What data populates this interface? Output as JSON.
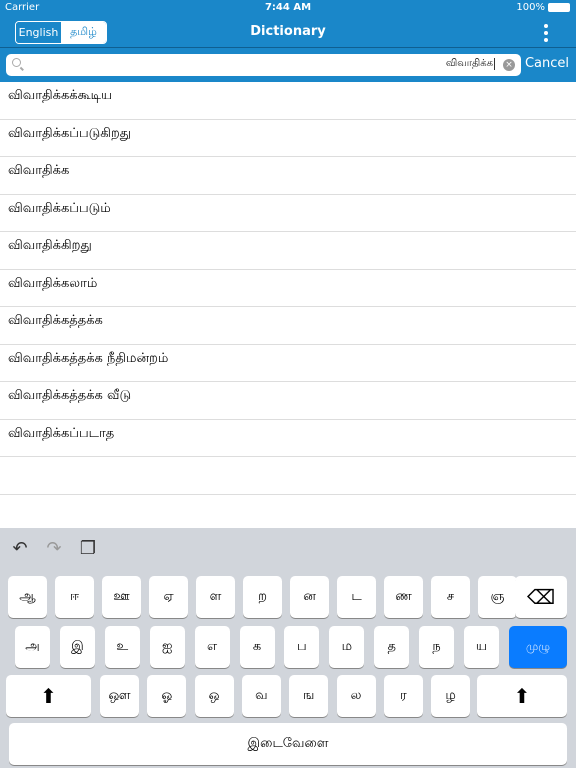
{
  "status": {
    "carrier": "Carrier",
    "time": "7:44 AM",
    "battery": "100%"
  },
  "nav": {
    "lang_english": "English",
    "lang_tamil": "தமிழ்",
    "title": "Dictionary"
  },
  "search": {
    "value": "விவாதிக்க",
    "cancel": "Cancel"
  },
  "results": [
    "விவாதிக்கக்கூடிய",
    "விவாதிக்கப்படுகிறது",
    "விவாதிக்க",
    "விவாதிக்கப்படும்",
    "விவாதிக்கிறது",
    "விவாதிக்கலாம்",
    "விவாதிக்கத்தக்க",
    "விவாதிக்கத்தக்க நீதிமன்றம்",
    "விவாதிக்கத்தக்க வீடு",
    "விவாதிக்கப்படாத"
  ],
  "keyboard": {
    "row1": [
      "ஆ",
      "ஈ",
      "ஊ",
      "ஏ",
      "ள",
      "ற",
      "ன",
      "ட",
      "ண",
      "ச",
      "ஞ"
    ],
    "row2": [
      "அ",
      "இ",
      "உ",
      "ஐ",
      "எ",
      "க",
      "ப",
      "ம",
      "த",
      "ந",
      "ய"
    ],
    "row2_action": "முழு",
    "row3": [
      "ஔ",
      "ஓ",
      "ஒ",
      "வ",
      "ங",
      "ல",
      "ர",
      "ழ"
    ],
    "space": "இடைவேளை"
  },
  "colors": {
    "accent": "#1a87c9",
    "key_action": "#0a7cff"
  }
}
